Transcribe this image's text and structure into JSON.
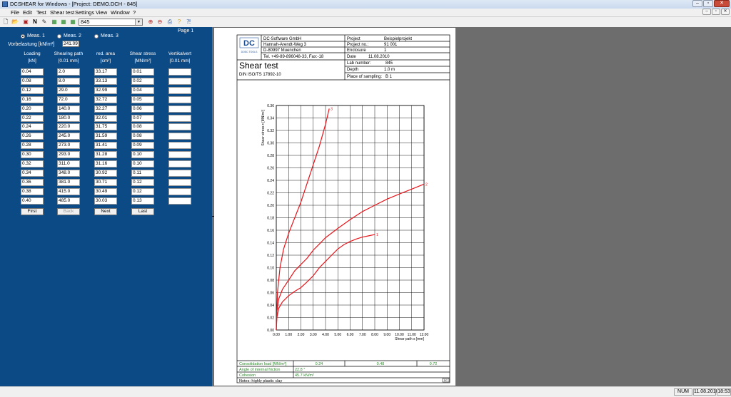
{
  "window": {
    "title": "DCSHEAR for Windows - [Project: DEMO.DCH - 845]"
  },
  "menu": [
    "File",
    "Edit",
    "Test",
    "Shear test",
    "Settings",
    "View",
    "Window",
    "?"
  ],
  "toolbar": {
    "sample_value": "845"
  },
  "left_panel": {
    "page_label": "Page 1",
    "radios": [
      {
        "label": "Meas. 1",
        "selected": true
      },
      {
        "label": "Meas. 2",
        "selected": false
      },
      {
        "label": "Meas. 3",
        "selected": false
      }
    ],
    "preload_label": "Vorbelastung [kN/m²]",
    "preload_value": "241.09",
    "columns": [
      {
        "name": "Loading",
        "unit": "[kN]"
      },
      {
        "name": "Shearing path",
        "unit": "[0.01 mm]"
      },
      {
        "name": "red. area",
        "unit": "[cm²]"
      },
      {
        "name": "Shear stress",
        "unit": "[MN/m²]"
      },
      {
        "name": "Vertikalvert",
        "unit": "[0.01 mm]"
      }
    ],
    "rows": [
      [
        "0.04",
        "2.0",
        "33.17",
        "0.01",
        ""
      ],
      [
        "0.08",
        "8.0",
        "33.13",
        "0.02",
        ""
      ],
      [
        "0.12",
        "29.0",
        "32.99",
        "0.04",
        ""
      ],
      [
        "0.16",
        "72.0",
        "32.72",
        "0.05",
        ""
      ],
      [
        "0.20",
        "140.0",
        "32.27",
        "0.06",
        ""
      ],
      [
        "0.22",
        "180.0",
        "32.01",
        "0.07",
        ""
      ],
      [
        "0.24",
        "220.0",
        "31.75",
        "0.08",
        ""
      ],
      [
        "0.26",
        "245.0",
        "31.59",
        "0.08",
        ""
      ],
      [
        "0.28",
        "273.0",
        "31.41",
        "0.09",
        ""
      ],
      [
        "0.30",
        "293.0",
        "31.28",
        "0.10",
        ""
      ],
      [
        "0.32",
        "311.0",
        "31.16",
        "0.10",
        ""
      ],
      [
        "0.34",
        "348.0",
        "30.92",
        "0.11",
        ""
      ],
      [
        "0.36",
        "381.0",
        "30.71",
        "0.12",
        ""
      ],
      [
        "0.38",
        "415.0",
        "30.49",
        "0.12",
        ""
      ],
      [
        "0.40",
        "485.0",
        "30.03",
        "0.13",
        ""
      ]
    ],
    "buttons": [
      "First",
      "Back",
      "Next",
      "Last"
    ]
  },
  "report": {
    "company": [
      "DC-Software GmbH",
      "Hannah-Arendt-Weg 3",
      "D-80997 Muenchen",
      "Tel. +49-89-896048-33, Fax:-18"
    ],
    "logo_text": "DC",
    "logo_sub": "DOSC TOOLS",
    "project_fields": [
      {
        "label": "Project",
        "value": "Beispielprojekt"
      },
      {
        "label": "Project no.:",
        "value": "91 001"
      },
      {
        "label": "Enclosure",
        "value": "1"
      },
      {
        "label": "Date",
        "value": "11.08.2010"
      }
    ],
    "title": "Shear test",
    "norm": "DIN ISO/TS 17892-10",
    "lab_fields": [
      {
        "label": "Lab number:",
        "value": "845"
      },
      {
        "label": "Depth",
        "value": "1.0 m"
      },
      {
        "label": "Place of sampling:",
        "value": "B 1"
      }
    ],
    "consolidation_label": "Consolidation load [MN/m²]",
    "consolidation_values": [
      "0.24",
      "0.48",
      "0.72"
    ],
    "friction_label": "Angle of internal friction",
    "friction_value": "22.8 °",
    "cohesion_label": "Cohesion",
    "cohesion_value": "45.7 kN/m²",
    "notes": "Notes: highly plastic clay",
    "corner_mark": "DC"
  },
  "chart_data": {
    "type": "line",
    "xlabel": "Shear path s [mm]",
    "ylabel": "Shear stress τ [MN/m²]",
    "xlim": [
      0,
      12
    ],
    "ylim": [
      0,
      0.36
    ],
    "xticks": [
      "0.00",
      "1.00",
      "2.00",
      "3.00",
      "4.00",
      "5.00",
      "6.00",
      "7.00",
      "8.00",
      "9.00",
      "10.00",
      "11.00",
      "12.00"
    ],
    "yticks": [
      "0.00",
      "0.02",
      "0.04",
      "0.06",
      "0.08",
      "0.10",
      "0.12",
      "0.14",
      "0.16",
      "0.18",
      "0.20",
      "0.22",
      "0.24",
      "0.26",
      "0.28",
      "0.30",
      "0.32",
      "0.34",
      "0.36"
    ],
    "grid": true,
    "series": [
      {
        "name": "1",
        "color": "#e8141a",
        "x": [
          0,
          0.05,
          0.2,
          0.5,
          1.0,
          1.5,
          2.0,
          2.5,
          3.0,
          3.5,
          4.0,
          4.5,
          5.0,
          5.5,
          6.0,
          6.5,
          7.0,
          7.5,
          8.0
        ],
        "y": [
          0,
          0.02,
          0.035,
          0.045,
          0.055,
          0.062,
          0.068,
          0.077,
          0.087,
          0.1,
          0.11,
          0.12,
          0.13,
          0.137,
          0.142,
          0.146,
          0.149,
          0.151,
          0.153
        ]
      },
      {
        "name": "2",
        "color": "#e8141a",
        "x": [
          0,
          0.05,
          0.2,
          0.5,
          1.0,
          1.5,
          2.0,
          2.5,
          3.0,
          3.5,
          4.0,
          5.0,
          6.0,
          7.0,
          8.0,
          9.0,
          10.0,
          11.0,
          12.0
        ],
        "y": [
          0,
          0.03,
          0.05,
          0.065,
          0.08,
          0.095,
          0.105,
          0.115,
          0.128,
          0.138,
          0.148,
          0.163,
          0.177,
          0.19,
          0.2,
          0.21,
          0.218,
          0.226,
          0.234
        ]
      },
      {
        "name": "3",
        "color": "#e8141a",
        "x": [
          0,
          0.1,
          0.3,
          0.6,
          1.0,
          1.5,
          2.0,
          2.5,
          3.0,
          3.5,
          4.0,
          4.3
        ],
        "y": [
          0,
          0.06,
          0.1,
          0.13,
          0.155,
          0.18,
          0.205,
          0.235,
          0.265,
          0.295,
          0.33,
          0.355
        ]
      }
    ]
  }
}
